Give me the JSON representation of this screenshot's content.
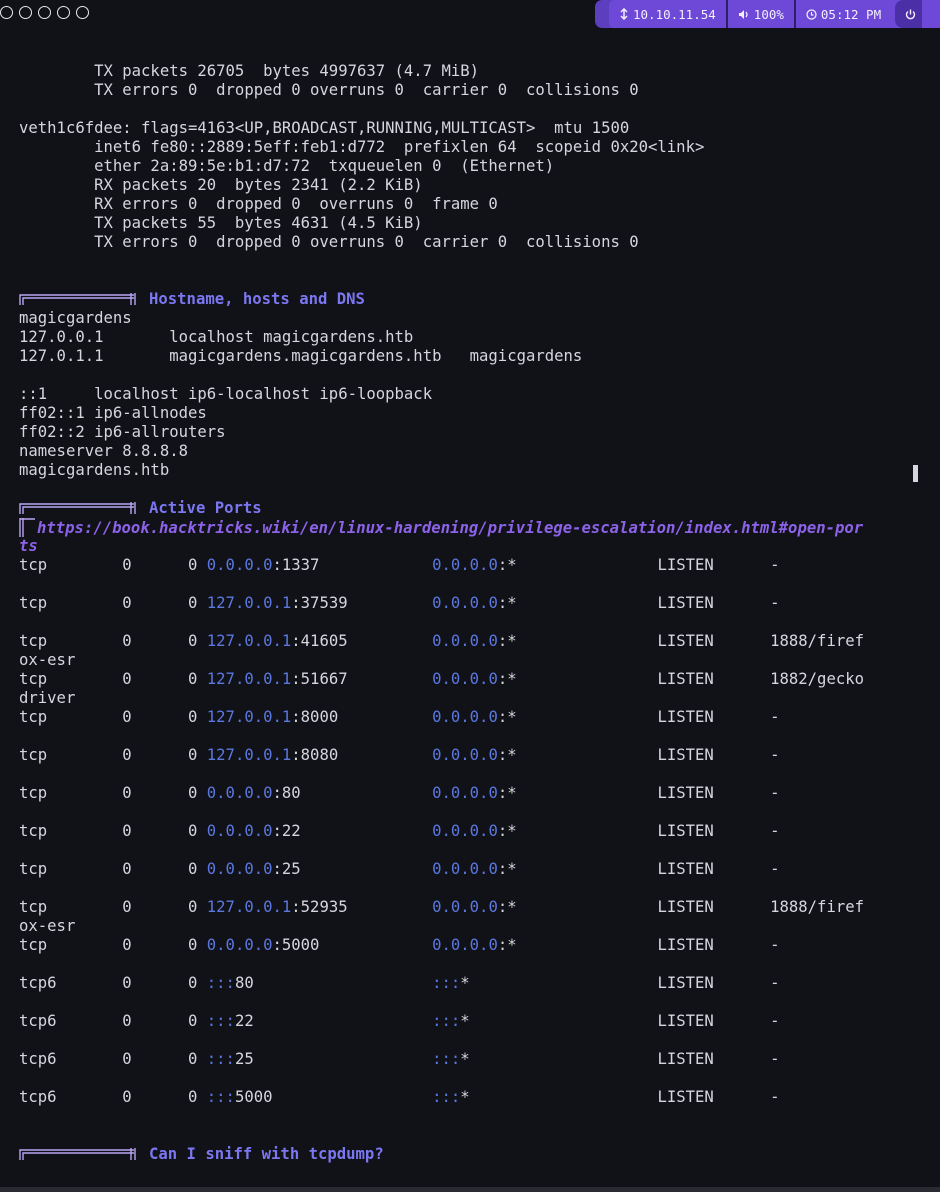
{
  "status_bar": {
    "workspaces": [
      "1",
      "2",
      "3",
      "4",
      "5"
    ],
    "ip": "10.10.11.54",
    "volume": "100%",
    "time": "05:12 PM"
  },
  "icons": {
    "network": "network-icon",
    "volume": "volume-icon",
    "clock": "clock-icon",
    "power": "power-icon"
  },
  "colors": {
    "accent": "#6e48d6",
    "header": "#7b77f0",
    "link": "#8c63e8",
    "ip": "#5a78e0",
    "bg": "#111118"
  },
  "lines_top": [
    "        TX packets 26705  bytes 4997637 (4.7 MiB)",
    "        TX errors 0  dropped 0 overruns 0  carrier 0  collisions 0",
    "",
    "veth1c6fdee: flags=4163<UP,BROADCAST,RUNNING,MULTICAST>  mtu 1500",
    "        inet6 fe80::2889:5eff:feb1:d772  prefixlen 64  scopeid 0x20<link>",
    "        ether 2a:89:5e:b1:d7:72  txqueuelen 0  (Ethernet)",
    "        RX packets 20  bytes 2341 (2.2 KiB)",
    "        RX errors 0  dropped 0  overruns 0  frame 0",
    "        TX packets 55  bytes 4631 (4.5 KiB)",
    "        TX errors 0  dropped 0 overruns 0  carrier 0  collisions 0",
    "",
    ""
  ],
  "section_hosts": {
    "title": "Hostname, hosts and DNS",
    "lines": [
      "magicgardens",
      "127.0.0.1       localhost magicgardens.htb",
      "127.0.1.1       magicgardens.magicgardens.htb   magicgardens",
      "",
      "::1     localhost ip6-localhost ip6-loopback",
      "ff02::1 ip6-allnodes",
      "ff02::2 ip6-allrouters",
      "nameserver 8.8.8.8",
      "magicgardens.htb",
      ""
    ]
  },
  "section_ports": {
    "title": "Active Ports",
    "link_line1": "https://book.hacktricks.wiki/en/linux-hardening/privilege-escalation/index.html#open-por",
    "link_line2": "ts",
    "rows": [
      {
        "proto": "tcp",
        "recv": "0",
        "send": "0",
        "laddr": "0.0.0.0",
        "lport": ":1337",
        "faddr": "0.0.0.0",
        "fport": ":*",
        "state": "LISTEN",
        "prog": "-",
        "wrap": ""
      },
      {
        "proto": "tcp",
        "recv": "0",
        "send": "0",
        "laddr": "127.0.0.1",
        "lport": ":37539",
        "faddr": "0.0.0.0",
        "fport": ":*",
        "state": "LISTEN",
        "prog": "-",
        "wrap": ""
      },
      {
        "proto": "tcp",
        "recv": "0",
        "send": "0",
        "laddr": "127.0.0.1",
        "lport": ":41605",
        "faddr": "0.0.0.0",
        "fport": ":*",
        "state": "LISTEN",
        "prog": "1888/firef",
        "wrap": "ox-esr"
      },
      {
        "proto": "tcp",
        "recv": "0",
        "send": "0",
        "laddr": "127.0.0.1",
        "lport": ":51667",
        "faddr": "0.0.0.0",
        "fport": ":*",
        "state": "LISTEN",
        "prog": "1882/gecko",
        "wrap": "driver"
      },
      {
        "proto": "tcp",
        "recv": "0",
        "send": "0",
        "laddr": "127.0.0.1",
        "lport": ":8000",
        "faddr": "0.0.0.0",
        "fport": ":*",
        "state": "LISTEN",
        "prog": "-",
        "wrap": ""
      },
      {
        "proto": "tcp",
        "recv": "0",
        "send": "0",
        "laddr": "127.0.0.1",
        "lport": ":8080",
        "faddr": "0.0.0.0",
        "fport": ":*",
        "state": "LISTEN",
        "prog": "-",
        "wrap": ""
      },
      {
        "proto": "tcp",
        "recv": "0",
        "send": "0",
        "laddr": "0.0.0.0",
        "lport": ":80",
        "faddr": "0.0.0.0",
        "fport": ":*",
        "state": "LISTEN",
        "prog": "-",
        "wrap": ""
      },
      {
        "proto": "tcp",
        "recv": "0",
        "send": "0",
        "laddr": "0.0.0.0",
        "lport": ":22",
        "faddr": "0.0.0.0",
        "fport": ":*",
        "state": "LISTEN",
        "prog": "-",
        "wrap": ""
      },
      {
        "proto": "tcp",
        "recv": "0",
        "send": "0",
        "laddr": "0.0.0.0",
        "lport": ":25",
        "faddr": "0.0.0.0",
        "fport": ":*",
        "state": "LISTEN",
        "prog": "-",
        "wrap": ""
      },
      {
        "proto": "tcp",
        "recv": "0",
        "send": "0",
        "laddr": "127.0.0.1",
        "lport": ":52935",
        "faddr": "0.0.0.0",
        "fport": ":*",
        "state": "LISTEN",
        "prog": "1888/firef",
        "wrap": "ox-esr"
      },
      {
        "proto": "tcp",
        "recv": "0",
        "send": "0",
        "laddr": "0.0.0.0",
        "lport": ":5000",
        "faddr": "0.0.0.0",
        "fport": ":*",
        "state": "LISTEN",
        "prog": "-",
        "wrap": ""
      },
      {
        "proto": "tcp6",
        "recv": "0",
        "send": "0",
        "laddr": ":::",
        "lport": "80",
        "faddr": ":::",
        "fport": "*",
        "state": "LISTEN",
        "prog": "-",
        "wrap": ""
      },
      {
        "proto": "tcp6",
        "recv": "0",
        "send": "0",
        "laddr": ":::",
        "lport": "22",
        "faddr": ":::",
        "fport": "*",
        "state": "LISTEN",
        "prog": "-",
        "wrap": ""
      },
      {
        "proto": "tcp6",
        "recv": "0",
        "send": "0",
        "laddr": ":::",
        "lport": "25",
        "faddr": ":::",
        "fport": "*",
        "state": "LISTEN",
        "prog": "-",
        "wrap": ""
      },
      {
        "proto": "tcp6",
        "recv": "0",
        "send": "0",
        "laddr": ":::",
        "lport": "5000",
        "faddr": ":::",
        "fport": "*",
        "state": "LISTEN",
        "prog": "-",
        "wrap": ""
      }
    ]
  },
  "section_sniff": {
    "title": "Can I sniff with tcpdump?"
  }
}
